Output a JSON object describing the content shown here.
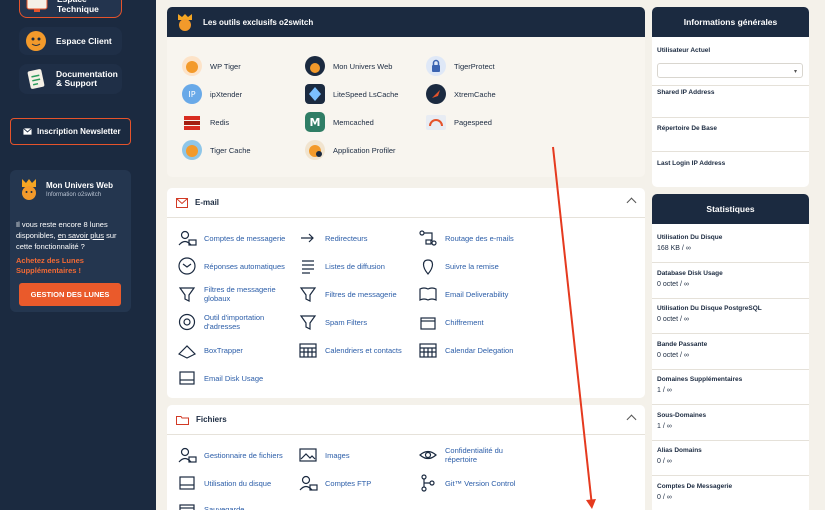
{
  "sidebar": {
    "items": [
      {
        "label": "Espace Technique"
      },
      {
        "label": "Espace Client"
      },
      {
        "label": "Documentation & Support"
      }
    ],
    "newsletter_label": "Inscription Newsletter",
    "moon_card": {
      "title": "Mon Univers Web",
      "subtitle": "Information o2switch",
      "text_before": "Il vous reste encore 8 lunes disponibles, ",
      "link": "en savoir plus",
      "text_after": " sur cette fonctionnalité ?",
      "cta": "Achetez des Lunes Supplémentaires !",
      "button": "GESTION DES LUNES"
    }
  },
  "tools": {
    "title": "Les outils exclusifs o2switch",
    "items": [
      "WP Tiger",
      "Mon Univers Web",
      "TigerProtect",
      "ipXtender",
      "LiteSpeed LsCache",
      "XtremCache",
      "Redis",
      "Memcached",
      "Pagespeed",
      "Tiger Cache",
      "Application Profiler"
    ]
  },
  "email": {
    "title": "E-mail",
    "items": [
      "Comptes de messagerie",
      "Redirecteurs",
      "Routage des e-mails",
      "Réponses automatiques",
      "Listes de diffusion",
      "Suivre la remise",
      "Filtres de messagerie globaux",
      "Filtres de messagerie",
      "Email Deliverability",
      "Outil d'importation d'adresses",
      "Spam Filters",
      "Chiffrement",
      "BoxTrapper",
      "Calendriers et contacts",
      "Calendar Delegation",
      "Email Disk Usage"
    ]
  },
  "files": {
    "title": "Fichiers",
    "items": [
      "Gestionnaire de fichiers",
      "Images",
      "Confidentialité du répertoire",
      "Utilisation du disque",
      "Comptes FTP",
      "Git™ Version Control",
      "Sauvegarde"
    ]
  },
  "info": {
    "title": "Informations générales",
    "user_label": "Utilisateur Actuel",
    "user_value": "",
    "shared_ip": "Shared IP Address",
    "home_dir": "Répertoire De Base",
    "last_login": "Last Login IP Address"
  },
  "stats": {
    "title": "Statistiques",
    "rows": [
      {
        "label": "Utilisation Du Disque",
        "value": "168 KB / ∞"
      },
      {
        "label": "Database Disk Usage",
        "value": "0 octet / ∞"
      },
      {
        "label": "Utilisation Du Disque PostgreSQL",
        "value": "0 octet / ∞"
      },
      {
        "label": "Bande Passante",
        "value": "0 octet / ∞"
      },
      {
        "label": "Domaines Supplémentaires",
        "value": "1 / ∞"
      },
      {
        "label": "Sous-Domaines",
        "value": "1 / ∞"
      },
      {
        "label": "Alias Domains",
        "value": "0 / ∞"
      },
      {
        "label": "Comptes De Messagerie",
        "value": "0 / ∞"
      }
    ]
  },
  "colors": {
    "navy": "#1b2a40",
    "accent": "#e5532b",
    "link": "#2b5da8"
  }
}
